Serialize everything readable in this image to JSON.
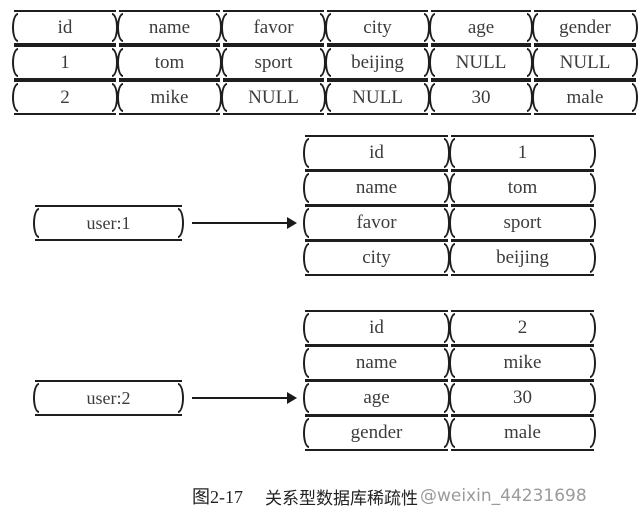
{
  "relational_table": {
    "columns": [
      "id",
      "name",
      "favor",
      "city",
      "age",
      "gender"
    ],
    "rows": [
      [
        "1",
        "tom",
        "sport",
        "beijing",
        "NULL",
        "NULL"
      ],
      [
        "2",
        "mike",
        "NULL",
        "NULL",
        "30",
        "male"
      ]
    ]
  },
  "hashes": [
    {
      "key": "user:1",
      "fields": [
        {
          "field": "id",
          "value": "1"
        },
        {
          "field": "name",
          "value": "tom"
        },
        {
          "field": "favor",
          "value": "sport"
        },
        {
          "field": "city",
          "value": "beijing"
        }
      ]
    },
    {
      "key": "user:2",
      "fields": [
        {
          "field": "id",
          "value": "2"
        },
        {
          "field": "name",
          "value": "mike"
        },
        {
          "field": "age",
          "value": "30"
        },
        {
          "field": "gender",
          "value": "male"
        }
      ]
    }
  ],
  "caption": {
    "figure_number": "图2-17",
    "title": "关系型数据库稀疏性",
    "watermark": "@weixin_44231698"
  }
}
